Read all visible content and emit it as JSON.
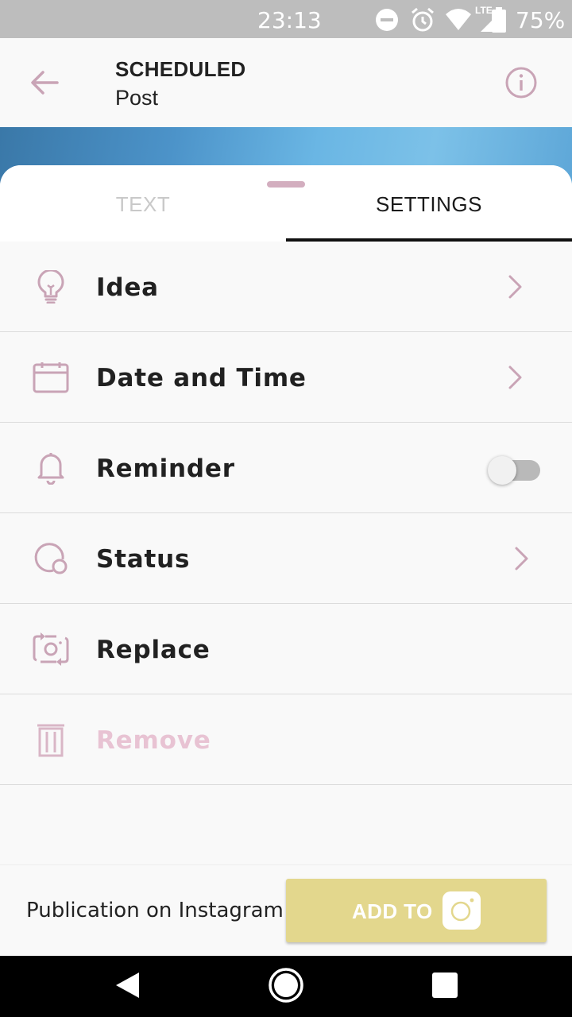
{
  "status_bar": {
    "time": "23:13",
    "battery": "75%",
    "network": "LTE",
    "icons": [
      "do-not-disturb-icon",
      "alarm-icon",
      "wifi-icon",
      "signal-icon",
      "battery-icon"
    ]
  },
  "header": {
    "title": "SCHEDULED",
    "subtitle": "Post",
    "back_icon": "arrow-left-icon",
    "info_icon": "info-icon"
  },
  "tabs": [
    {
      "label": "TEXT",
      "active": false
    },
    {
      "label": "SETTINGS",
      "active": true
    }
  ],
  "settings": [
    {
      "label": "Idea",
      "icon": "lightbulb-icon",
      "control": "chevron"
    },
    {
      "label": "Date and Time",
      "icon": "calendar-icon",
      "control": "chevron"
    },
    {
      "label": "Reminder",
      "icon": "bell-icon",
      "control": "toggle",
      "toggle_on": false
    },
    {
      "label": "Status",
      "icon": "status-icon",
      "control": "chevron"
    },
    {
      "label": "Replace",
      "icon": "replace-camera-icon",
      "control": "none"
    },
    {
      "label": "Remove",
      "icon": "trash-icon",
      "control": "none",
      "disabled": true
    }
  ],
  "bottom": {
    "publication_text": "Publication on Instagram",
    "add_button_label": "ADD TO",
    "add_button_icon": "instagram-icon"
  },
  "colors": {
    "accent": "#c9a4b6",
    "button": "#e3d78d",
    "muted_text": "#e8c3d3",
    "status_bar": "#bdbdbd"
  },
  "nav_bar": {
    "buttons": [
      "back-nav-icon",
      "home-nav-icon",
      "recents-nav-icon"
    ]
  }
}
